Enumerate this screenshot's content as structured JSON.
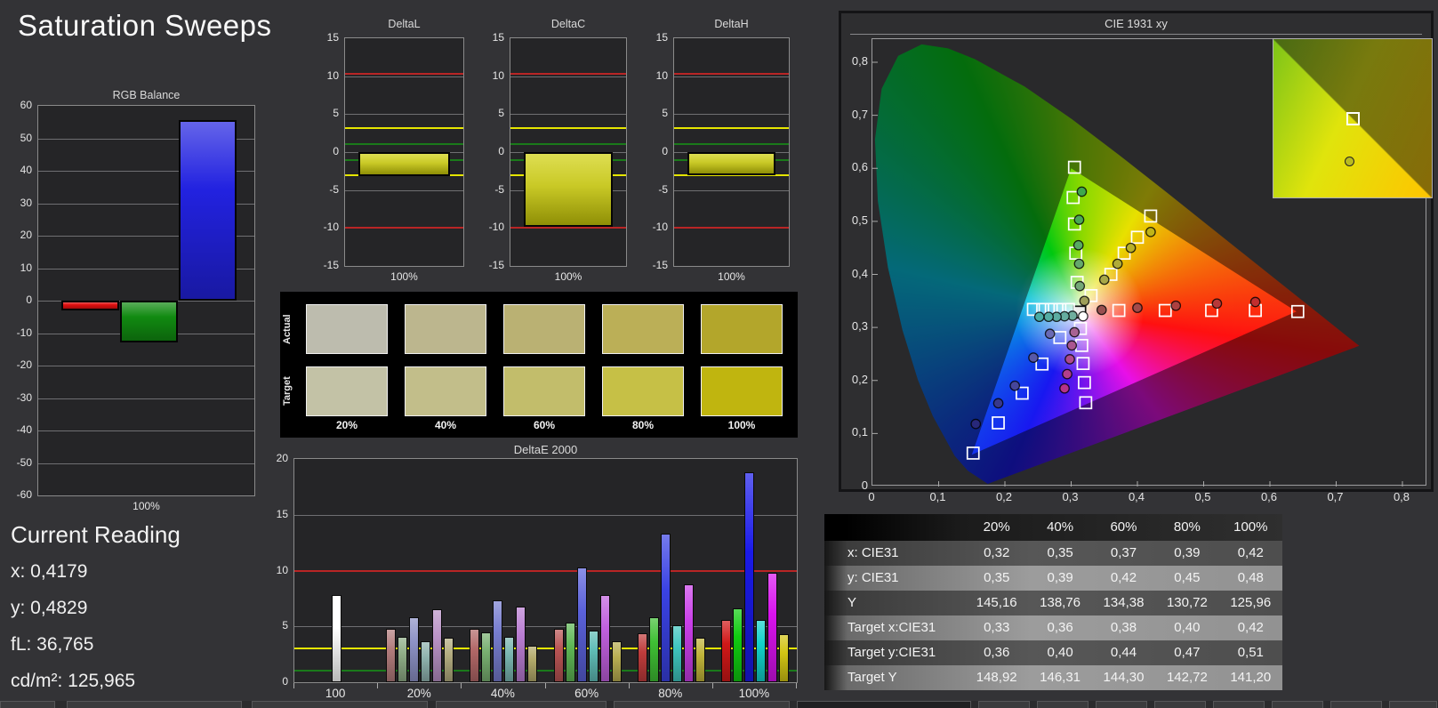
{
  "app": {
    "title": "Saturation Sweeps"
  },
  "current_reading": {
    "heading": "Current Reading",
    "x": "x: 0,4179",
    "y": "y: 0,4829",
    "fl": "fL: 36,765",
    "cdm2": "cd/m²: 125,965"
  },
  "chart_data": [
    {
      "id": "rgb-balance",
      "type": "bar",
      "title": "RGB Balance",
      "categories": [
        "Red",
        "Green",
        "Blue"
      ],
      "values": [
        -3,
        -13,
        55.5
      ],
      "bar_colors": [
        "#e01010",
        "#118a11",
        "#2222e0"
      ],
      "xlabel": "100%",
      "ylabel": "",
      "ylim": [
        -60,
        60
      ],
      "ytick_step": 10,
      "grid": true
    },
    {
      "id": "delta-l",
      "type": "bar",
      "title": "DeltaL",
      "categories": [
        "100%"
      ],
      "values": [
        -3.2
      ],
      "bar_color": "#c9c926",
      "xlabel": "100%",
      "ylim": [
        -15,
        15
      ],
      "ytick_step": 5,
      "grid": true,
      "ref_lines": [
        {
          "v": 10.3,
          "color": "#b92525"
        },
        {
          "v": -10,
          "color": "#b92525"
        },
        {
          "v": 3.2,
          "color": "#e6e600"
        },
        {
          "v": -3,
          "color": "#e6e600"
        },
        {
          "v": 1.1,
          "color": "#1a7a1a"
        },
        {
          "v": -1,
          "color": "#1a7a1a"
        }
      ]
    },
    {
      "id": "delta-c",
      "type": "bar",
      "title": "DeltaC",
      "categories": [
        "100%"
      ],
      "values": [
        -9.9
      ],
      "bar_color": "#c9c926",
      "xlabel": "100%",
      "ylim": [
        -15,
        15
      ],
      "ytick_step": 5,
      "grid": true,
      "ref_lines": [
        {
          "v": 10.3,
          "color": "#b92525"
        },
        {
          "v": -10,
          "color": "#b92525"
        },
        {
          "v": 3.2,
          "color": "#e6e600"
        },
        {
          "v": -3,
          "color": "#e6e600"
        },
        {
          "v": 1.1,
          "color": "#1a7a1a"
        },
        {
          "v": -1,
          "color": "#1a7a1a"
        }
      ]
    },
    {
      "id": "delta-h",
      "type": "bar",
      "title": "DeltaH",
      "categories": [
        "100%"
      ],
      "values": [
        -3.1
      ],
      "bar_color": "#c9c926",
      "xlabel": "100%",
      "ylim": [
        -15,
        15
      ],
      "ytick_step": 5,
      "grid": true,
      "ref_lines": [
        {
          "v": 10.3,
          "color": "#b92525"
        },
        {
          "v": -10,
          "color": "#b92525"
        },
        {
          "v": 3.2,
          "color": "#e6e600"
        },
        {
          "v": -3,
          "color": "#e6e600"
        },
        {
          "v": 1.1,
          "color": "#1a7a1a"
        },
        {
          "v": -1,
          "color": "#1a7a1a"
        }
      ]
    },
    {
      "id": "delta-e",
      "type": "bar",
      "title": "DeltaE 2000",
      "ylim": [
        0,
        20
      ],
      "ytick_step": 5,
      "grid": true,
      "ref_lines": [
        {
          "v": 10,
          "color": "#b92525"
        },
        {
          "v": 3,
          "color": "#e6e600"
        },
        {
          "v": 1,
          "color": "#1a7a1a"
        }
      ],
      "groups": [
        {
          "label": "100",
          "colors": [
            "#ffffff"
          ],
          "values": [
            7.8
          ]
        },
        {
          "label": "20%",
          "colors": [
            "#b27c7c",
            "#8fac86",
            "#8d92c6",
            "#8fb2ae",
            "#b992c6",
            "#b2ab7f"
          ],
          "values": [
            4.8,
            4.1,
            5.8,
            3.7,
            6.5,
            4.0
          ]
        },
        {
          "label": "40%",
          "colors": [
            "#b26868",
            "#79b071",
            "#777dcf",
            "#79b5b0",
            "#b97dd2",
            "#b2a96a"
          ],
          "values": [
            4.8,
            4.5,
            7.3,
            4.1,
            6.8,
            3.3
          ]
        },
        {
          "label": "60%",
          "colors": [
            "#b85454",
            "#5fb755",
            "#5a61da",
            "#5fbcb6",
            "#c160de",
            "#b8ae52"
          ],
          "values": [
            4.8,
            5.3,
            10.3,
            4.6,
            7.8,
            3.7
          ]
        },
        {
          "label": "80%",
          "colors": [
            "#c03c3c",
            "#3fc034",
            "#3a42e4",
            "#3fc6bf",
            "#ca3fe9",
            "#c0b43a"
          ],
          "values": [
            4.4,
            5.8,
            13.3,
            5.1,
            8.8,
            4.0
          ]
        },
        {
          "label": "100%",
          "colors": [
            "#d01818",
            "#10cc10",
            "#1a1ae8",
            "#12d2ca",
            "#d912ef",
            "#d2c414"
          ],
          "values": [
            5.6,
            6.6,
            18.8,
            5.6,
            9.8,
            4.3
          ]
        }
      ]
    },
    {
      "id": "cie",
      "type": "scatter",
      "title": "CIE 1931 xy",
      "x_ticks": [
        "0",
        "0,1",
        "0,2",
        "0,3",
        "0,4",
        "0,5",
        "0,6",
        "0,7",
        "0,8"
      ],
      "y_ticks": [
        "0",
        "0,1",
        "0,2",
        "0,3",
        "0,4",
        "0,5",
        "0,6",
        "0,7",
        "0,8"
      ],
      "xlim": [
        0,
        0.8375
      ],
      "ylim": [
        0,
        0.8435
      ],
      "targets": {
        "white": [
          [
            0.313,
            0.329
          ]
        ],
        "red": [
          [
            0.372,
            0.332
          ],
          [
            0.442,
            0.332
          ],
          [
            0.512,
            0.332
          ],
          [
            0.578,
            0.332
          ],
          [
            0.642,
            0.33
          ]
        ],
        "green": [
          [
            0.309,
            0.385
          ],
          [
            0.307,
            0.44
          ],
          [
            0.305,
            0.495
          ],
          [
            0.303,
            0.545
          ],
          [
            0.305,
            0.602
          ]
        ],
        "blue": [
          [
            0.283,
            0.281
          ],
          [
            0.256,
            0.231
          ],
          [
            0.226,
            0.176
          ],
          [
            0.19,
            0.12
          ],
          [
            0.152,
            0.063
          ]
        ],
        "cyan": [
          [
            0.296,
            0.334
          ],
          [
            0.283,
            0.334
          ],
          [
            0.27,
            0.334
          ],
          [
            0.257,
            0.334
          ],
          [
            0.243,
            0.334
          ]
        ],
        "magenta": [
          [
            0.314,
            0.298
          ],
          [
            0.316,
            0.266
          ],
          [
            0.318,
            0.232
          ],
          [
            0.32,
            0.196
          ],
          [
            0.322,
            0.158
          ]
        ],
        "yellow": [
          [
            0.33,
            0.36
          ],
          [
            0.36,
            0.4
          ],
          [
            0.38,
            0.44
          ],
          [
            0.4,
            0.47
          ],
          [
            0.42,
            0.51
          ]
        ]
      },
      "measured": {
        "white": [
          [
            0.318,
            0.321,
            "#ffffff"
          ]
        ],
        "red": [
          [
            0.346,
            0.333,
            "#9a5050"
          ],
          [
            0.4,
            0.337,
            "#a34a4a"
          ],
          [
            0.458,
            0.341,
            "#ad4040"
          ],
          [
            0.52,
            0.345,
            "#b83838"
          ],
          [
            0.578,
            0.348,
            "#c22e2e"
          ]
        ],
        "green": [
          [
            0.313,
            0.378,
            "#74a878"
          ],
          [
            0.312,
            0.42,
            "#65a86c"
          ],
          [
            0.311,
            0.455,
            "#58aa62"
          ],
          [
            0.312,
            0.503,
            "#4aa956"
          ],
          [
            0.316,
            0.556,
            "#3ea84c"
          ]
        ],
        "blue": [
          [
            0.268,
            0.288,
            "#6a6ab4"
          ],
          [
            0.243,
            0.243,
            "#5858a8"
          ],
          [
            0.215,
            0.19,
            "#46469a"
          ],
          [
            0.19,
            0.157,
            "#38388c"
          ],
          [
            0.156,
            0.118,
            "#28287a"
          ]
        ],
        "cyan": [
          [
            0.302,
            0.322,
            "#6fae9e"
          ],
          [
            0.29,
            0.321,
            "#65ada0"
          ],
          [
            0.278,
            0.32,
            "#5cada2"
          ],
          [
            0.266,
            0.32,
            "#54ada4"
          ],
          [
            0.252,
            0.32,
            "#4aada6"
          ]
        ],
        "magenta": [
          [
            0.305,
            0.291,
            "#a86292"
          ],
          [
            0.301,
            0.266,
            "#aa5690"
          ],
          [
            0.298,
            0.24,
            "#ae4a8e"
          ],
          [
            0.294,
            0.212,
            "#b23e8c"
          ],
          [
            0.29,
            0.185,
            "#b6328a"
          ]
        ],
        "yellow": [
          [
            0.32,
            0.35,
            "#9e9e58"
          ],
          [
            0.35,
            0.39,
            "#a8a848"
          ],
          [
            0.37,
            0.42,
            "#b0ac38"
          ],
          [
            0.39,
            0.45,
            "#b8b028"
          ],
          [
            0.42,
            0.48,
            "#c0b418"
          ]
        ]
      },
      "inset": {
        "region": {
          "x0": 0.37,
          "y0": 0.46,
          "span": 0.1
        },
        "target": [
          0.42,
          0.51
        ],
        "measured": [
          0.4179,
          0.4829,
          "#b9bb20"
        ]
      }
    }
  ],
  "swatches": {
    "row_labels": [
      "Actual",
      "Target"
    ],
    "percents": [
      "20%",
      "40%",
      "60%",
      "80%",
      "100%"
    ],
    "actual": [
      "#bdbcae",
      "#bcb68e",
      "#bab173",
      "#bbaf57",
      "#b3a62b"
    ],
    "target": [
      "#c3c2a6",
      "#c2be8a",
      "#c2bd6b",
      "#c6c046",
      "#c0b50f"
    ]
  },
  "table": {
    "col_headers": [
      "20%",
      "40%",
      "60%",
      "80%",
      "100%"
    ],
    "rows": [
      {
        "label": "x: CIE31",
        "values": [
          "0,32",
          "0,35",
          "0,37",
          "0,39",
          "0,42"
        ]
      },
      {
        "label": "y: CIE31",
        "values": [
          "0,35",
          "0,39",
          "0,42",
          "0,45",
          "0,48"
        ]
      },
      {
        "label": "Y",
        "values": [
          "145,16",
          "138,76",
          "134,38",
          "130,72",
          "125,96"
        ]
      },
      {
        "label": "Target x:CIE31",
        "values": [
          "0,33",
          "0,36",
          "0,38",
          "0,40",
          "0,42"
        ]
      },
      {
        "label": "Target y:CIE31",
        "values": [
          "0,36",
          "0,40",
          "0,44",
          "0,47",
          "0,51"
        ]
      },
      {
        "label": "Target Y",
        "values": [
          "148,92",
          "146,31",
          "144,30",
          "142,72",
          "141,20"
        ]
      }
    ]
  }
}
